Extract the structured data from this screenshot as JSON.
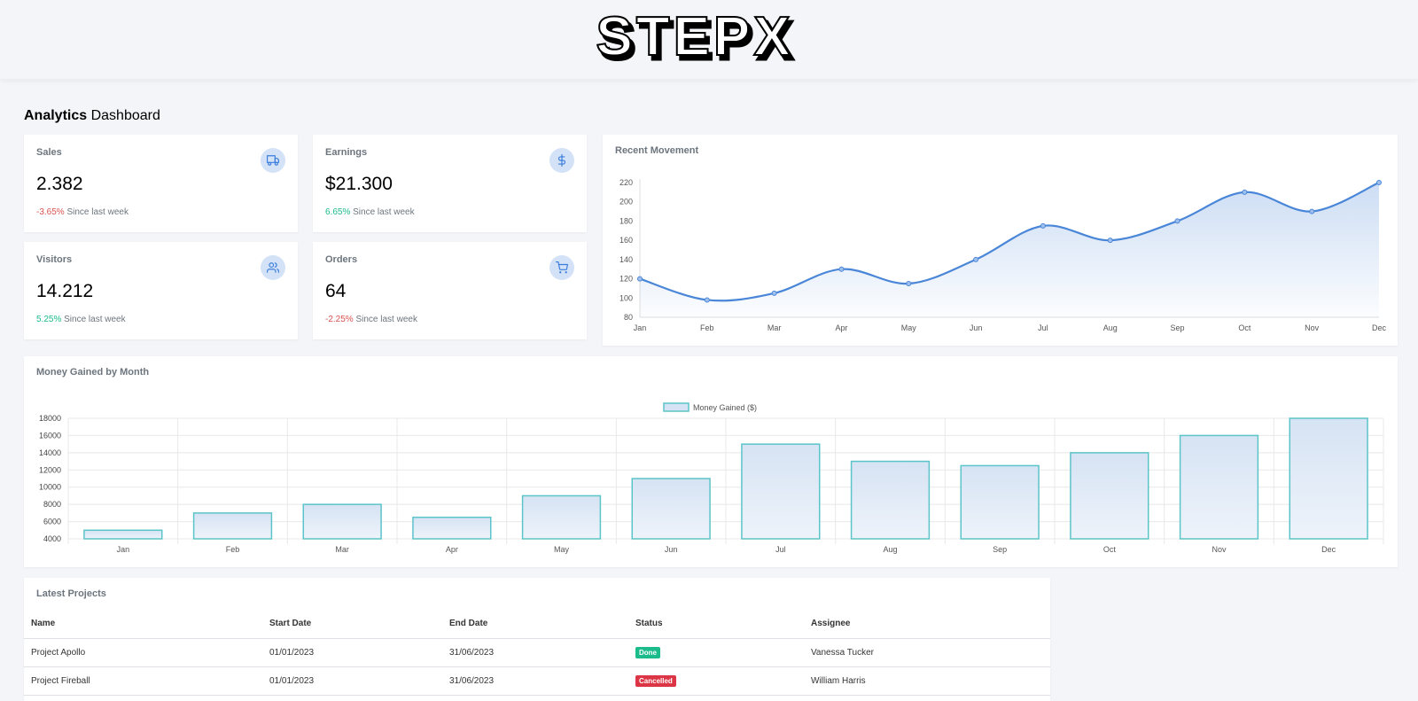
{
  "brand": {
    "logo_text": "STEPX"
  },
  "page_title": {
    "bold": "Analytics",
    "rest": " Dashboard"
  },
  "stats": [
    {
      "label": "Sales",
      "value": "2.382",
      "change": "-3.65%",
      "change_type": "negative",
      "since": " Since last week",
      "icon": "truck-icon"
    },
    {
      "label": "Earnings",
      "value": "$21.300",
      "change": "6.65%",
      "change_type": "positive",
      "since": " Since last week",
      "icon": "dollar-icon"
    },
    {
      "label": "Visitors",
      "value": "14.212",
      "change": "5.25%",
      "change_type": "positive",
      "since": " Since last week",
      "icon": "users-icon"
    },
    {
      "label": "Orders",
      "value": "64",
      "change": "-2.25%",
      "change_type": "negative",
      "since": " Since last week",
      "icon": "cart-icon"
    }
  ],
  "recent_movement": {
    "title": "Recent Movement"
  },
  "money_gained": {
    "title": "Money Gained by Month"
  },
  "chart_data": [
    {
      "type": "area",
      "title": "Recent Movement",
      "categories": [
        "Jan",
        "Feb",
        "Mar",
        "Apr",
        "May",
        "Jun",
        "Jul",
        "Aug",
        "Sep",
        "Oct",
        "Nov",
        "Dec"
      ],
      "series": [
        {
          "values": [
            120,
            98,
            105,
            130,
            115,
            140,
            175,
            160,
            180,
            210,
            190,
            220
          ]
        }
      ],
      "ylim": [
        80,
        220
      ],
      "yticks": [
        80,
        100,
        120,
        140,
        160,
        180,
        200,
        220
      ],
      "line_color": "#4a86d8"
    },
    {
      "type": "bar",
      "title": "Money Gained by Month",
      "categories": [
        "Jan",
        "Feb",
        "Mar",
        "Apr",
        "May",
        "Jun",
        "Jul",
        "Aug",
        "Sep",
        "Oct",
        "Nov",
        "Dec"
      ],
      "series": [
        {
          "name": "Money Gained ($)",
          "values": [
            5000,
            7000,
            8000,
            6500,
            9000,
            11000,
            15000,
            13000,
            12500,
            14000,
            16000,
            18000
          ]
        }
      ],
      "ylim": [
        4000,
        18000
      ],
      "yticks": [
        4000,
        6000,
        8000,
        10000,
        12000,
        14000,
        16000,
        18000
      ],
      "bar_border_color": "#5bc4c8",
      "grid": true,
      "legend": "top-center"
    }
  ],
  "projects": {
    "title": "Latest Projects",
    "columns": [
      "Name",
      "Start Date",
      "End Date",
      "Status",
      "Assignee"
    ],
    "rows": [
      {
        "name": "Project Apollo",
        "start": "01/01/2023",
        "end": "31/06/2023",
        "status": "Done",
        "status_color": "#1cbb8c",
        "assignee": "Vanessa Tucker"
      },
      {
        "name": "Project Fireball",
        "start": "01/01/2023",
        "end": "31/06/2023",
        "status": "Cancelled",
        "status_color": "#dc3545",
        "assignee": "William Harris"
      }
    ]
  }
}
